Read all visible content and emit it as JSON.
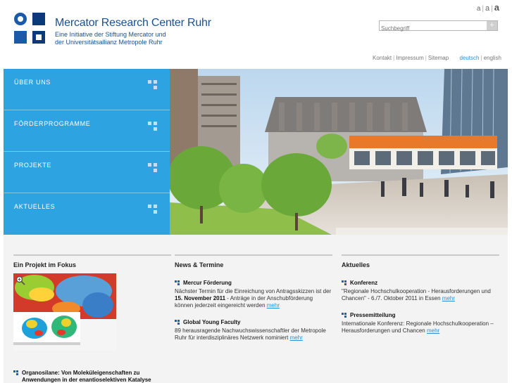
{
  "header": {
    "title": "Mercator Research Center Ruhr",
    "subtitle_line1": "Eine Initiative der Stiftung Mercator und",
    "subtitle_line2": "der Universitätsallianz Metropole Ruhr",
    "font_sizes": [
      "a",
      "a",
      "a"
    ],
    "font_sep": "|",
    "search_placeholder": "Suchbegriff",
    "search_button": "+"
  },
  "util_nav": {
    "links": [
      "Kontakt",
      "Impressum",
      "Sitemap"
    ],
    "sep": "|",
    "lang_de": "deutsch",
    "lang_en": "english"
  },
  "nav": {
    "items": [
      {
        "label": "ÜBER UNS"
      },
      {
        "label": "FÖRDERPROGRAMME"
      },
      {
        "label": "PROJEKTE"
      },
      {
        "label": "AKTUELLES"
      }
    ]
  },
  "columns": {
    "focus": {
      "heading": "Ein Projekt im Fokus",
      "project_title": "Organosilane: Von Moleküleigenschaften zu Anwendungen in der enantioselektiven Katalyse"
    },
    "news": {
      "heading": "News & Termine",
      "items": [
        {
          "title": "Mercur Förderung",
          "text_before": "Nächster Termin für die Einreichung von Antragsskizzen ist der ",
          "text_bold": "15. November 2011",
          "text_after": " - Anträge in der Anschubförderung können jederzeit eingereicht werden ",
          "more": "mehr"
        },
        {
          "title": "Global Young Faculty",
          "text": "89 herausragende Nachwuchswissenschaftler der Metropole Ruhr für interdisziplinäres Netzwerk nominiert ",
          "more": "mehr"
        }
      ]
    },
    "aktuelles": {
      "heading": "Aktuelles",
      "items": [
        {
          "title": "Konferenz",
          "text": "\"Regionale Hochschulkooperation - Herausforderungen und Chancen\" - 6./7. Oktober 2011 in Essen ",
          "more": "mehr"
        },
        {
          "title": "Pressemitteilung",
          "text": "Internationale Konferenz: Regionale Hochschulkooperation – Herausforderungen und Chancen ",
          "more": "mehr"
        }
      ]
    }
  },
  "colors": {
    "nav_blue": "#2ea3e1",
    "brand_blue": "#1b4f8f",
    "link_blue": "#2a8fd8"
  }
}
